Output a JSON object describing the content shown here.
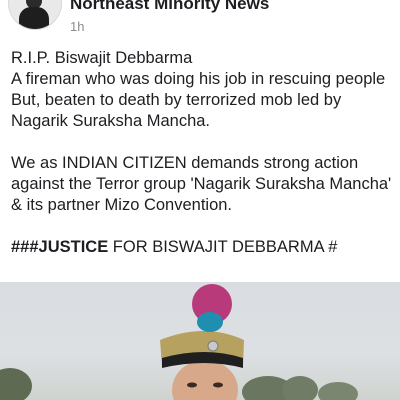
{
  "post": {
    "author": "Northeast Minority News",
    "time": "1h",
    "lines": [
      "R.I.P. Biswajit Debbarma",
      "A fireman who was doing his job in rescuing people",
      "But, beaten to death by terrorized mob led by Nagarik Suraksha Mancha.",
      "We as INDIAN CITIZEN demands strong action against the Terror group 'Nagarik Suraksha Mancha' & its partner Mizo Convention."
    ],
    "justice": {
      "hashes": "###",
      "bold": "JUSTICE",
      "rest": " FOR BISWAJIT DEBBARMA #"
    }
  },
  "icons": {
    "avatar": "profile-avatar-icon"
  },
  "colors": {
    "name": "#1c1e21",
    "meta": "#8a8d91",
    "cap_plume": "#b83a7a"
  }
}
